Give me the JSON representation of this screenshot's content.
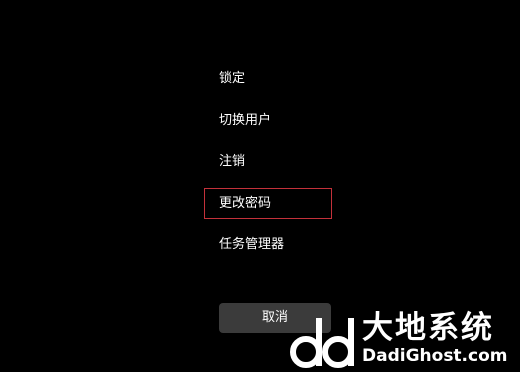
{
  "menu": {
    "items": [
      {
        "label": "锁定"
      },
      {
        "label": "切换用户"
      },
      {
        "label": "注销"
      },
      {
        "label": "更改密码"
      },
      {
        "label": "任务管理器"
      }
    ],
    "focused_item": "更改密码"
  },
  "cancel_button": {
    "label": "取消"
  },
  "watermark": {
    "brand_cn": "大地系统",
    "brand_en": "DadiGhost.com"
  },
  "colors": {
    "background": "#000000",
    "text": "#ffffff",
    "focus_border": "#c4313a",
    "button_bg": "#3b3b3b"
  }
}
